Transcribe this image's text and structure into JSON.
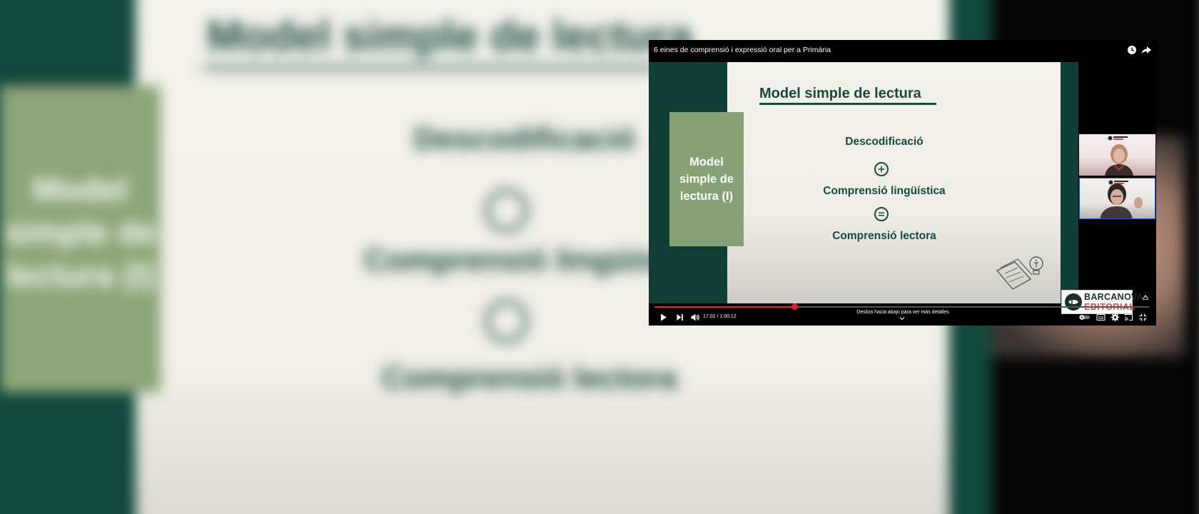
{
  "player": {
    "title": "6 eines de comprensió i expressió oral per a Primària",
    "top_icons": [
      "clock-icon",
      "share-icon"
    ],
    "time_display": "17:02 / 1:00:12",
    "progress": 0.2834,
    "swipe_hint": "Desliza hacia abajo para ver más detalles",
    "controls": [
      "play-icon",
      "next-icon",
      "volume-icon",
      "autoplay-toggle-icon",
      "captions-icon",
      "settings-icon",
      "cast-icon",
      "exit-fullscreen-icon"
    ]
  },
  "slide": {
    "title": "Model simple de lectura",
    "box_label": "Model simple de lectura (I)",
    "term1": "Descodificació",
    "operator1": "+",
    "term2": "Comprensió lingüística",
    "operator2": "=",
    "term3": "Comprensió lectora"
  },
  "watermark": {
    "line1": "BARCANOVA",
    "line2": "EDITORIAL"
  },
  "colors": {
    "slide_green_dark": "#123f35",
    "slide_green_light": "#85a175",
    "progress_red": "#e8202c",
    "brand_red": "#d44a3a"
  }
}
